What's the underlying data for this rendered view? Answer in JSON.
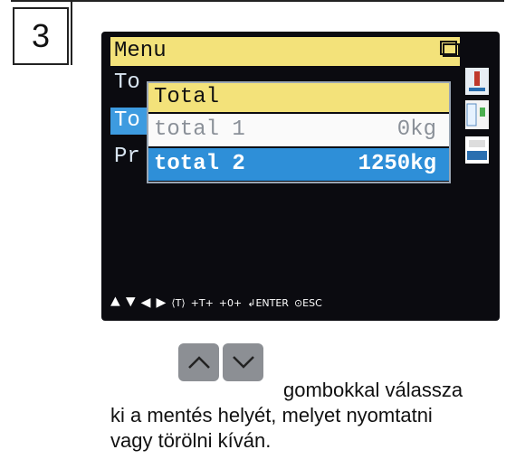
{
  "step": {
    "number": "3"
  },
  "screen": {
    "menu_title": "Menu",
    "bg_rows": [
      {
        "label": "To",
        "selected": false
      },
      {
        "label": "To",
        "selected": true
      },
      {
        "label": "Pr",
        "selected": false
      }
    ],
    "popup": {
      "title": "Total",
      "items": [
        {
          "name": "total 1",
          "value": "0kg",
          "selected": false
        },
        {
          "name": "total 2",
          "value": "1250kg",
          "selected": true
        }
      ]
    },
    "bottom_bar": {
      "enter_label": "ENTER",
      "esc_label": "ESC",
      "t_label": "T",
      "t_pm_label": "+T+",
      "zero_label": "+0+"
    }
  },
  "instructions": {
    "line1": "gombokkal válassza",
    "line2": "ki a mentés helyét, melyet nyomtatni",
    "line3": "vagy törölni kíván."
  }
}
